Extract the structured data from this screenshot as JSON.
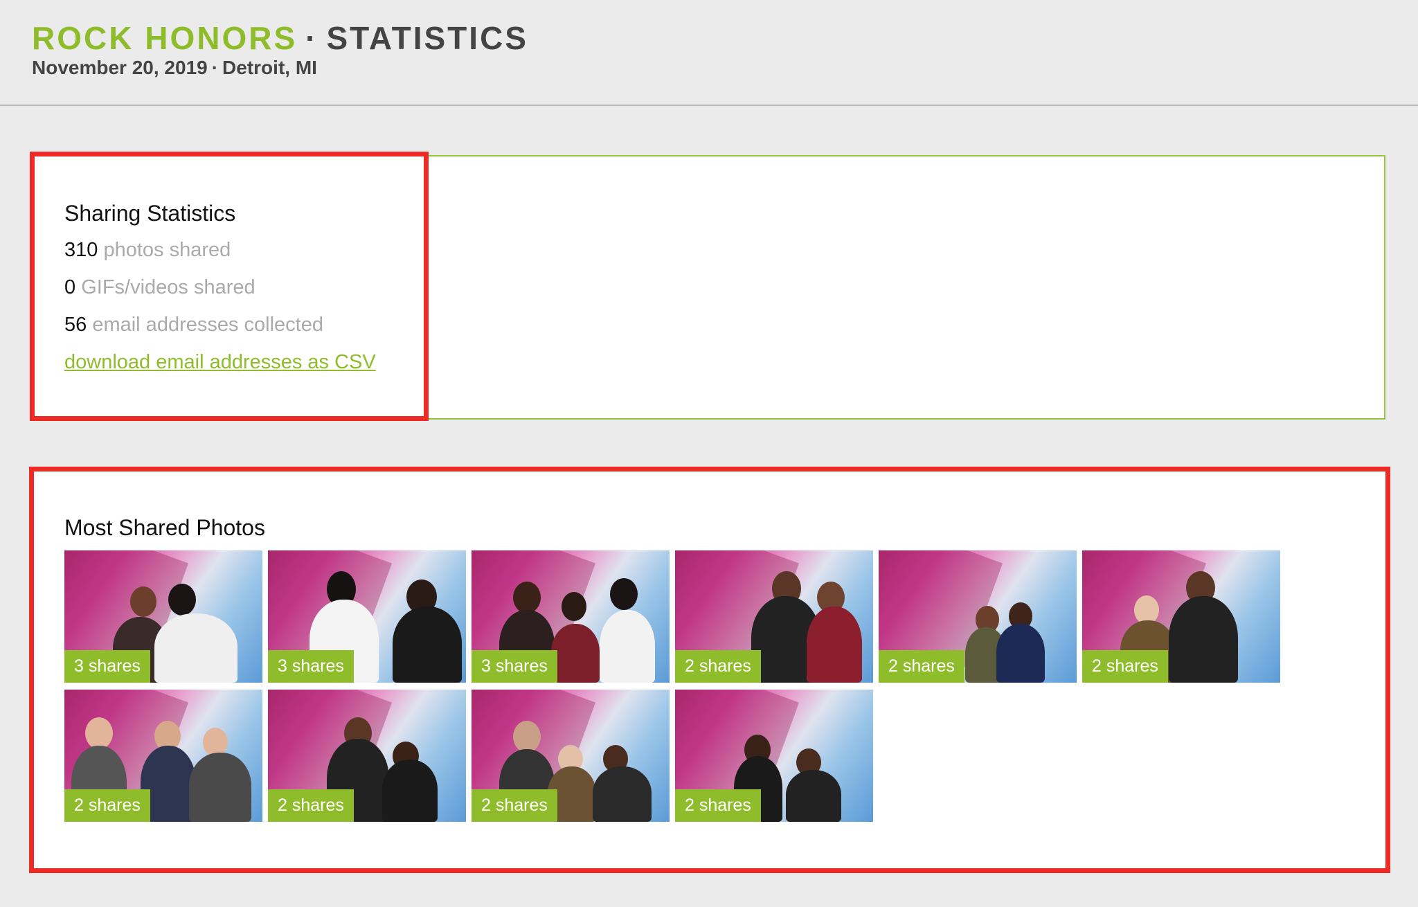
{
  "header": {
    "brand": "ROCK HONORS",
    "separator": "·",
    "page_title": "STATISTICS",
    "date": "November 20, 2019",
    "dot": "·",
    "location": "Detroit, MI"
  },
  "sharing_stats": {
    "heading": "Sharing Statistics",
    "photos_count": "310",
    "photos_label": "photos shared",
    "gifs_count": "0",
    "gifs_label": "GIFs/videos shared",
    "emails_count": "56",
    "emails_label": "email addresses collected",
    "download_link": "download email addresses as CSV"
  },
  "most_shared": {
    "heading": "Most Shared Photos",
    "photos": [
      {
        "shares": "3 shares"
      },
      {
        "shares": "3 shares"
      },
      {
        "shares": "3 shares"
      },
      {
        "shares": "2 shares"
      },
      {
        "shares": "2 shares"
      },
      {
        "shares": "2 shares"
      },
      {
        "shares": "2 shares"
      },
      {
        "shares": "2 shares"
      },
      {
        "shares": "2 shares"
      },
      {
        "shares": "2 shares"
      }
    ]
  },
  "colors": {
    "brand_green": "#8fbc2b",
    "highlight_red": "#ee2a24",
    "panel_border": "#94c53a"
  }
}
